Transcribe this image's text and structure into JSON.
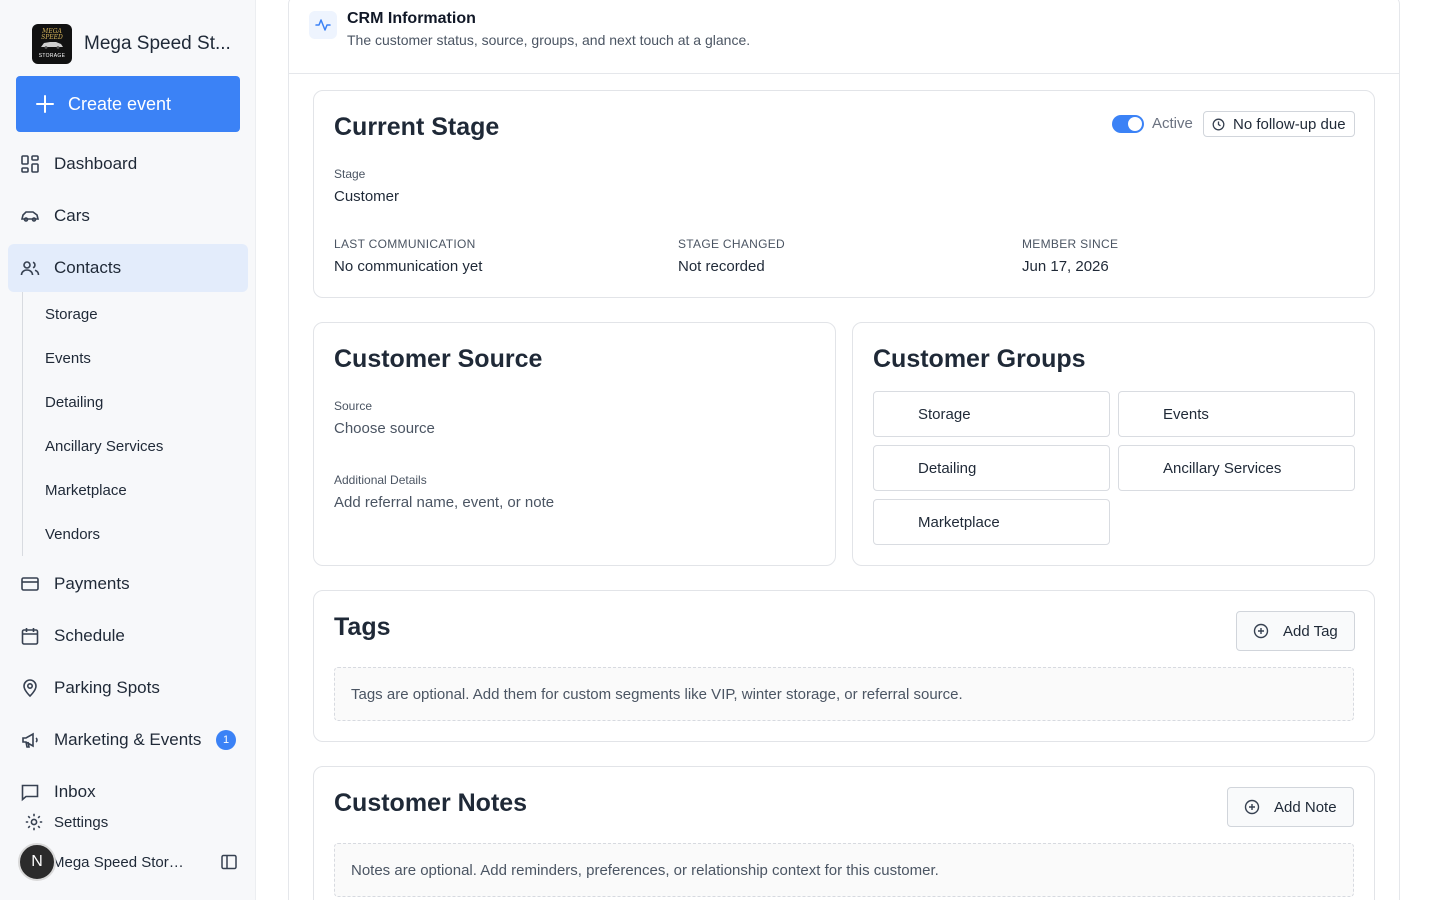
{
  "sidebar": {
    "brand_name": "Mega Speed St...",
    "logo": {
      "top_text": "MEGA SPEED",
      "bottom_text": "STORAGE"
    },
    "create_label": "Create event",
    "nav": {
      "dashboard": "Dashboard",
      "cars": "Cars",
      "contacts": "Contacts",
      "payments": "Payments",
      "schedule": "Schedule",
      "parking": "Parking Spots",
      "marketing": "Marketing & Events",
      "marketing_badge": "1",
      "inbox": "Inbox",
      "settings": "Settings"
    },
    "contacts_sub": [
      "Storage",
      "Events",
      "Detailing",
      "Ancillary Services",
      "Marketplace",
      "Vendors"
    ],
    "user": {
      "initial": "N",
      "name": "Mega Speed Storag..."
    }
  },
  "crm": {
    "title": "CRM Information",
    "subtitle": "The customer status, source, groups, and next touch at a glance."
  },
  "stage": {
    "title": "Current Stage",
    "toggle_label": "Active",
    "followup": "No follow-up due",
    "stage_label": "Stage",
    "stage_value": "Customer",
    "last_comm_label": "LAST COMMUNICATION",
    "last_comm_value": "No communication yet",
    "stage_changed_label": "STAGE CHANGED",
    "stage_changed_value": "Not recorded",
    "member_since_label": "MEMBER SINCE",
    "member_since_value": "Jun 17, 2026"
  },
  "source": {
    "title": "Customer Source",
    "source_label": "Source",
    "source_placeholder": "Choose source",
    "details_label": "Additional Details",
    "details_placeholder": "Add referral name, event, or note"
  },
  "groups": {
    "title": "Customer Groups",
    "items": [
      "Storage",
      "Events",
      "Detailing",
      "Ancillary Services",
      "Marketplace"
    ]
  },
  "tags": {
    "title": "Tags",
    "add_label": "Add Tag",
    "empty_text": "Tags are optional. Add them for custom segments like VIP, winter storage, or referral source."
  },
  "notes": {
    "title": "Customer Notes",
    "add_label": "Add Note",
    "empty_text": "Notes are optional. Add reminders, preferences, or relationship context for this customer."
  },
  "colors": {
    "accent": "#3b82f6",
    "active_nav_bg": "#e3ecfb",
    "sidebar_bg": "#f7f8fa"
  }
}
